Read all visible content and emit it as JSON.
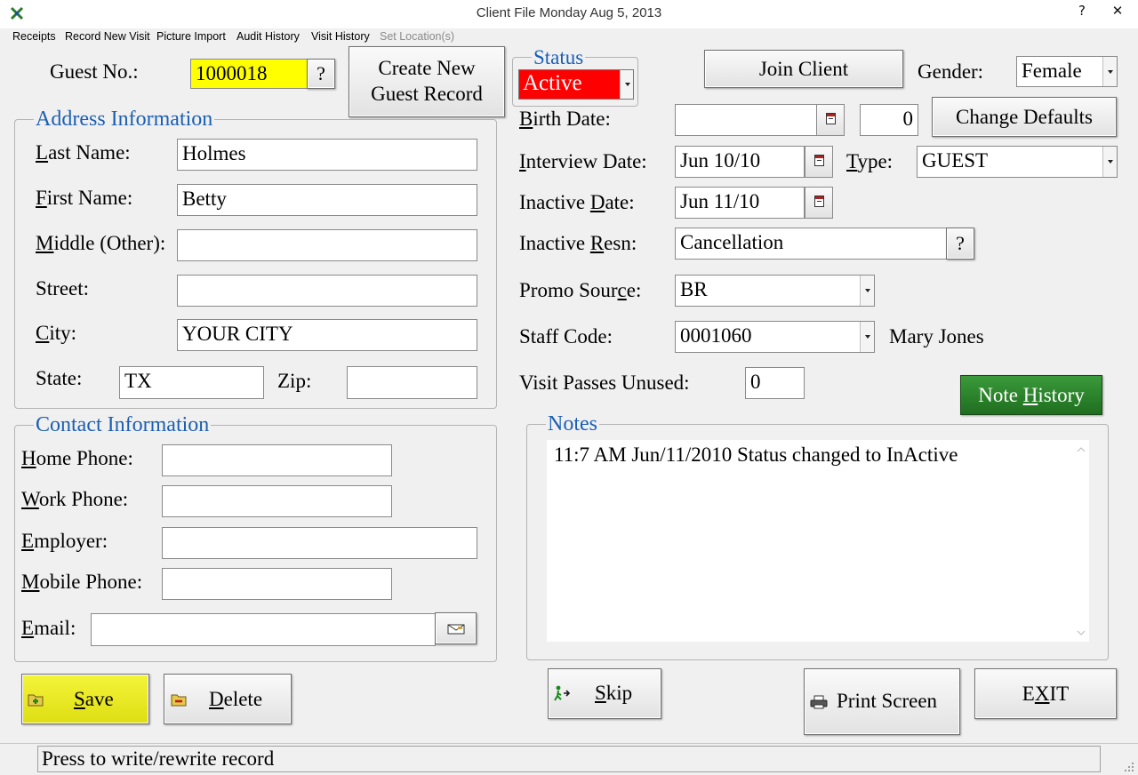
{
  "window": {
    "title": "Client File      Monday   Aug 5, 2013",
    "help_glyph": "?",
    "close_glyph": "✕"
  },
  "menu": {
    "receipts": "Receipts",
    "record_new_visit": "Record New Visit",
    "picture_import": "Picture Import",
    "audit_history": "Audit History",
    "visit_history": "Visit History",
    "set_location": "Set Location(s)"
  },
  "guest": {
    "label": "Guest No.:",
    "value": "1000018",
    "lookup": "?",
    "highlight": "#ffff00"
  },
  "create_button": {
    "line1": "Create New",
    "line2": "Guest Record"
  },
  "status": {
    "label": "Status",
    "value": "Active",
    "color": "#ff0000"
  },
  "join_button": "Join Client",
  "gender": {
    "label": "Gender:",
    "value": "Female"
  },
  "address": {
    "title": "Address Information",
    "last_name": {
      "u": "L",
      "rest": "ast Name:",
      "value": "Holmes"
    },
    "first_name": {
      "u": "F",
      "rest": "irst Name:",
      "value": "Betty"
    },
    "middle": {
      "u": "M",
      "rest": "iddle (Other):",
      "value": ""
    },
    "street": {
      "label": "Street:",
      "value": ""
    },
    "city": {
      "u": "C",
      "rest": "ity:",
      "value": "YOUR CITY"
    },
    "state": {
      "label": "State:",
      "value": "TX"
    },
    "zip": {
      "label": "Zip:",
      "value": ""
    }
  },
  "contact": {
    "title": "Contact Information",
    "home_phone": {
      "u": "H",
      "rest": "ome Phone:",
      "value": ""
    },
    "work_phone": {
      "u": "W",
      "rest": "ork Phone:",
      "value": ""
    },
    "employer": {
      "u": "E",
      "rest": "mployer:",
      "value": ""
    },
    "mobile_phone": {
      "u": "M",
      "rest": "obile Phone:",
      "value": ""
    },
    "email": {
      "u": "E",
      "rest": "mail:",
      "value": ""
    }
  },
  "right": {
    "birth_date": {
      "u": "B",
      "rest": "irth Date:",
      "value": "",
      "age": "0"
    },
    "change_defaults": "Change Defaults",
    "interview_date": {
      "u": "I",
      "rest": "nterview Date:",
      "value": "Jun 10/10"
    },
    "type": {
      "u": "T",
      "rest": "ype:",
      "value": "GUEST"
    },
    "inactive_date": {
      "pre": "Inactive ",
      "u": "D",
      "rest": "ate:",
      "value": "Jun 11/10"
    },
    "inactive_resn": {
      "pre": "Inactive ",
      "u": "R",
      "rest": "esn:",
      "value": "Cancellation",
      "lookup": "?"
    },
    "promo_source": {
      "pre": "Promo Sour",
      "u": "c",
      "rest": "e:",
      "value": "BR"
    },
    "staff_code": {
      "label": "Staff Code:",
      "value": "0001060",
      "name": "Mary Jones"
    },
    "visit_passes": {
      "label": "Visit Passes Unused:",
      "value": "0"
    }
  },
  "note_history": {
    "pre": "Note ",
    "u": "H",
    "rest": "istory",
    "color": "#2e8b2e"
  },
  "notes": {
    "title": "Notes",
    "text": "11:7 AM Jun/11/2010 Status changed to InActive"
  },
  "buttons": {
    "save": {
      "u": "S",
      "rest": "ave",
      "color": "#eeee22"
    },
    "delete": {
      "u": "D",
      "rest": "elete"
    },
    "skip": {
      "u": "S",
      "rest": "kip"
    },
    "print_screen": "Print Screen",
    "exit": {
      "pre": "E",
      "u": "X",
      "rest": "IT"
    }
  },
  "statusbar": "Press to write/rewrite record"
}
